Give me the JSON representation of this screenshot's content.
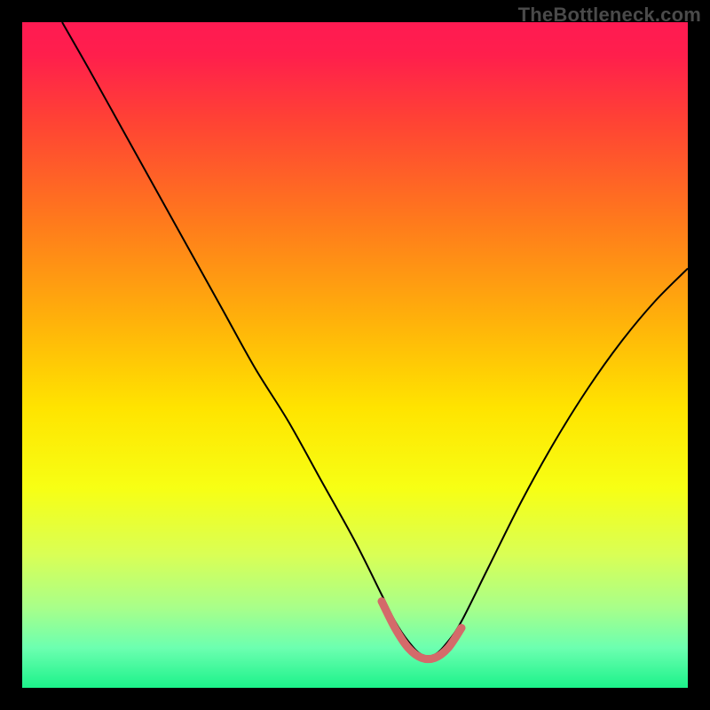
{
  "watermark": "TheBottleneck.com",
  "chart_data": {
    "type": "line",
    "title": "",
    "xlabel": "",
    "ylabel": "",
    "xlim": [
      0,
      100
    ],
    "ylim": [
      0,
      100
    ],
    "background_gradient": {
      "stops": [
        {
          "offset": 0.0,
          "color": "#ff1a52"
        },
        {
          "offset": 0.05,
          "color": "#ff1f4c"
        },
        {
          "offset": 0.15,
          "color": "#ff4334"
        },
        {
          "offset": 0.3,
          "color": "#ff7a1c"
        },
        {
          "offset": 0.45,
          "color": "#ffb20a"
        },
        {
          "offset": 0.58,
          "color": "#ffe400"
        },
        {
          "offset": 0.7,
          "color": "#f7ff14"
        },
        {
          "offset": 0.8,
          "color": "#d9ff55"
        },
        {
          "offset": 0.88,
          "color": "#a8ff8a"
        },
        {
          "offset": 0.94,
          "color": "#6cffb0"
        },
        {
          "offset": 1.0,
          "color": "#1cf28a"
        }
      ]
    },
    "series": [
      {
        "name": "bottleneck-curve",
        "color": "#000000",
        "width": 2.0,
        "x": [
          6,
          10,
          15,
          20,
          25,
          30,
          35,
          40,
          45,
          50,
          54,
          56,
          58,
          60,
          62,
          64,
          66,
          70,
          75,
          80,
          85,
          90,
          95,
          100
        ],
        "y": [
          100,
          93,
          84,
          75,
          66,
          57,
          48,
          40,
          31,
          22,
          14,
          10,
          7,
          5,
          5,
          7,
          10,
          18,
          28,
          37,
          45,
          52,
          58,
          63
        ]
      },
      {
        "name": "optimal-range-underline",
        "color": "#d46a6a",
        "width": 9.0,
        "linecap": "round",
        "x": [
          54,
          56,
          58,
          60,
          62,
          64,
          66
        ],
        "y": [
          13,
          9,
          6,
          4.5,
          4.5,
          6,
          9
        ]
      }
    ]
  }
}
